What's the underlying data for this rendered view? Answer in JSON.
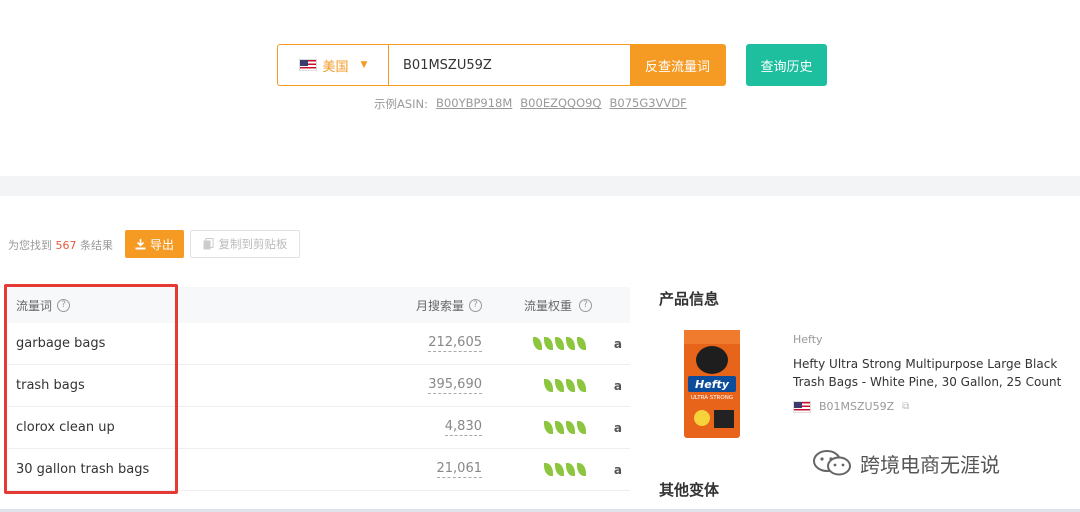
{
  "search": {
    "country": "美国",
    "asin_value": "B01MSZU59Z",
    "reverse_label": "反查流量词",
    "history_label": "查询历史",
    "example_prefix": "示例ASIN:",
    "examples": [
      "B00YBP918M",
      "B00EZQQO9Q",
      "B075G3VVDF"
    ]
  },
  "toolbar": {
    "result_prefix": "为您找到",
    "result_count": "567",
    "result_suffix": "条结果",
    "export_label": "导出",
    "copy_label": "复制到剪贴板"
  },
  "table": {
    "headers": {
      "keyword": "流量词",
      "volume": "月搜索量",
      "weight": "流量权重",
      "help": "?"
    },
    "amazon_glyph": "a",
    "rows": [
      {
        "keyword": "garbage bags",
        "volume": "212,605",
        "weight": 5
      },
      {
        "keyword": "trash bags",
        "volume": "395,690",
        "weight": 4
      },
      {
        "keyword": "clorox clean up",
        "volume": "4,830",
        "weight": 4
      },
      {
        "keyword": "30 gallon trash bags",
        "volume": "21,061",
        "weight": 4
      }
    ]
  },
  "product": {
    "section_title": "产品信息",
    "brand": "Hefty",
    "name": "Hefty Ultra Strong Multipurpose Large Black Trash Bags - White Pine, 30 Gallon, 25 Count",
    "asin": "B01MSZU59Z",
    "package_text": "Hefty",
    "package_subtext": "ULTRA STRONG",
    "variants_title": "其他变体"
  },
  "watermark": {
    "text": "跨境电商无涯说"
  },
  "colors": {
    "accent": "#f59a23",
    "teal": "#1dbf9f",
    "highlight": "#e53935",
    "leaf": "#8cc63f"
  }
}
